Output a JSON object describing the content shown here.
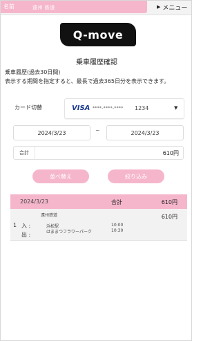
{
  "header": {
    "name_label": "名前",
    "name_value": "遠州 鉄道",
    "menu_label": "メニュー",
    "menu_icon": "triangle-right-icon"
  },
  "logo": {
    "text": "Q-move"
  },
  "page": {
    "title": "乗車履歴確認",
    "period": "乗車履歴(過去30日間)",
    "description": "表示する期間を指定すると、最長で過去365日分を表示できます。"
  },
  "card": {
    "label": "カード切替",
    "brand": "VISA",
    "masked_number": "****-****-****",
    "last4": "1234",
    "dropdown_icon": "caret-down-icon"
  },
  "date_range": {
    "from": "2024/3/23",
    "separator": "~",
    "to": "2024/3/23"
  },
  "total": {
    "label": "合計",
    "value": "610円"
  },
  "buttons": {
    "sort": "並べ替え",
    "filter": "絞り込み"
  },
  "history": {
    "date": "2024/3/23",
    "total_label": "合計",
    "total_amount": "610円",
    "entries": [
      {
        "company": "遠州鉄道",
        "amount": "610円",
        "number": "1",
        "in_label": "入 :",
        "out_label": "出 :",
        "in_station": "浜松駅",
        "out_station": "はままつフラワーパーク",
        "in_time": "10:00",
        "out_time": "10:30"
      }
    ]
  },
  "colors": {
    "accent_pink": "#f5b6cc",
    "logo_bg": "#111111"
  }
}
